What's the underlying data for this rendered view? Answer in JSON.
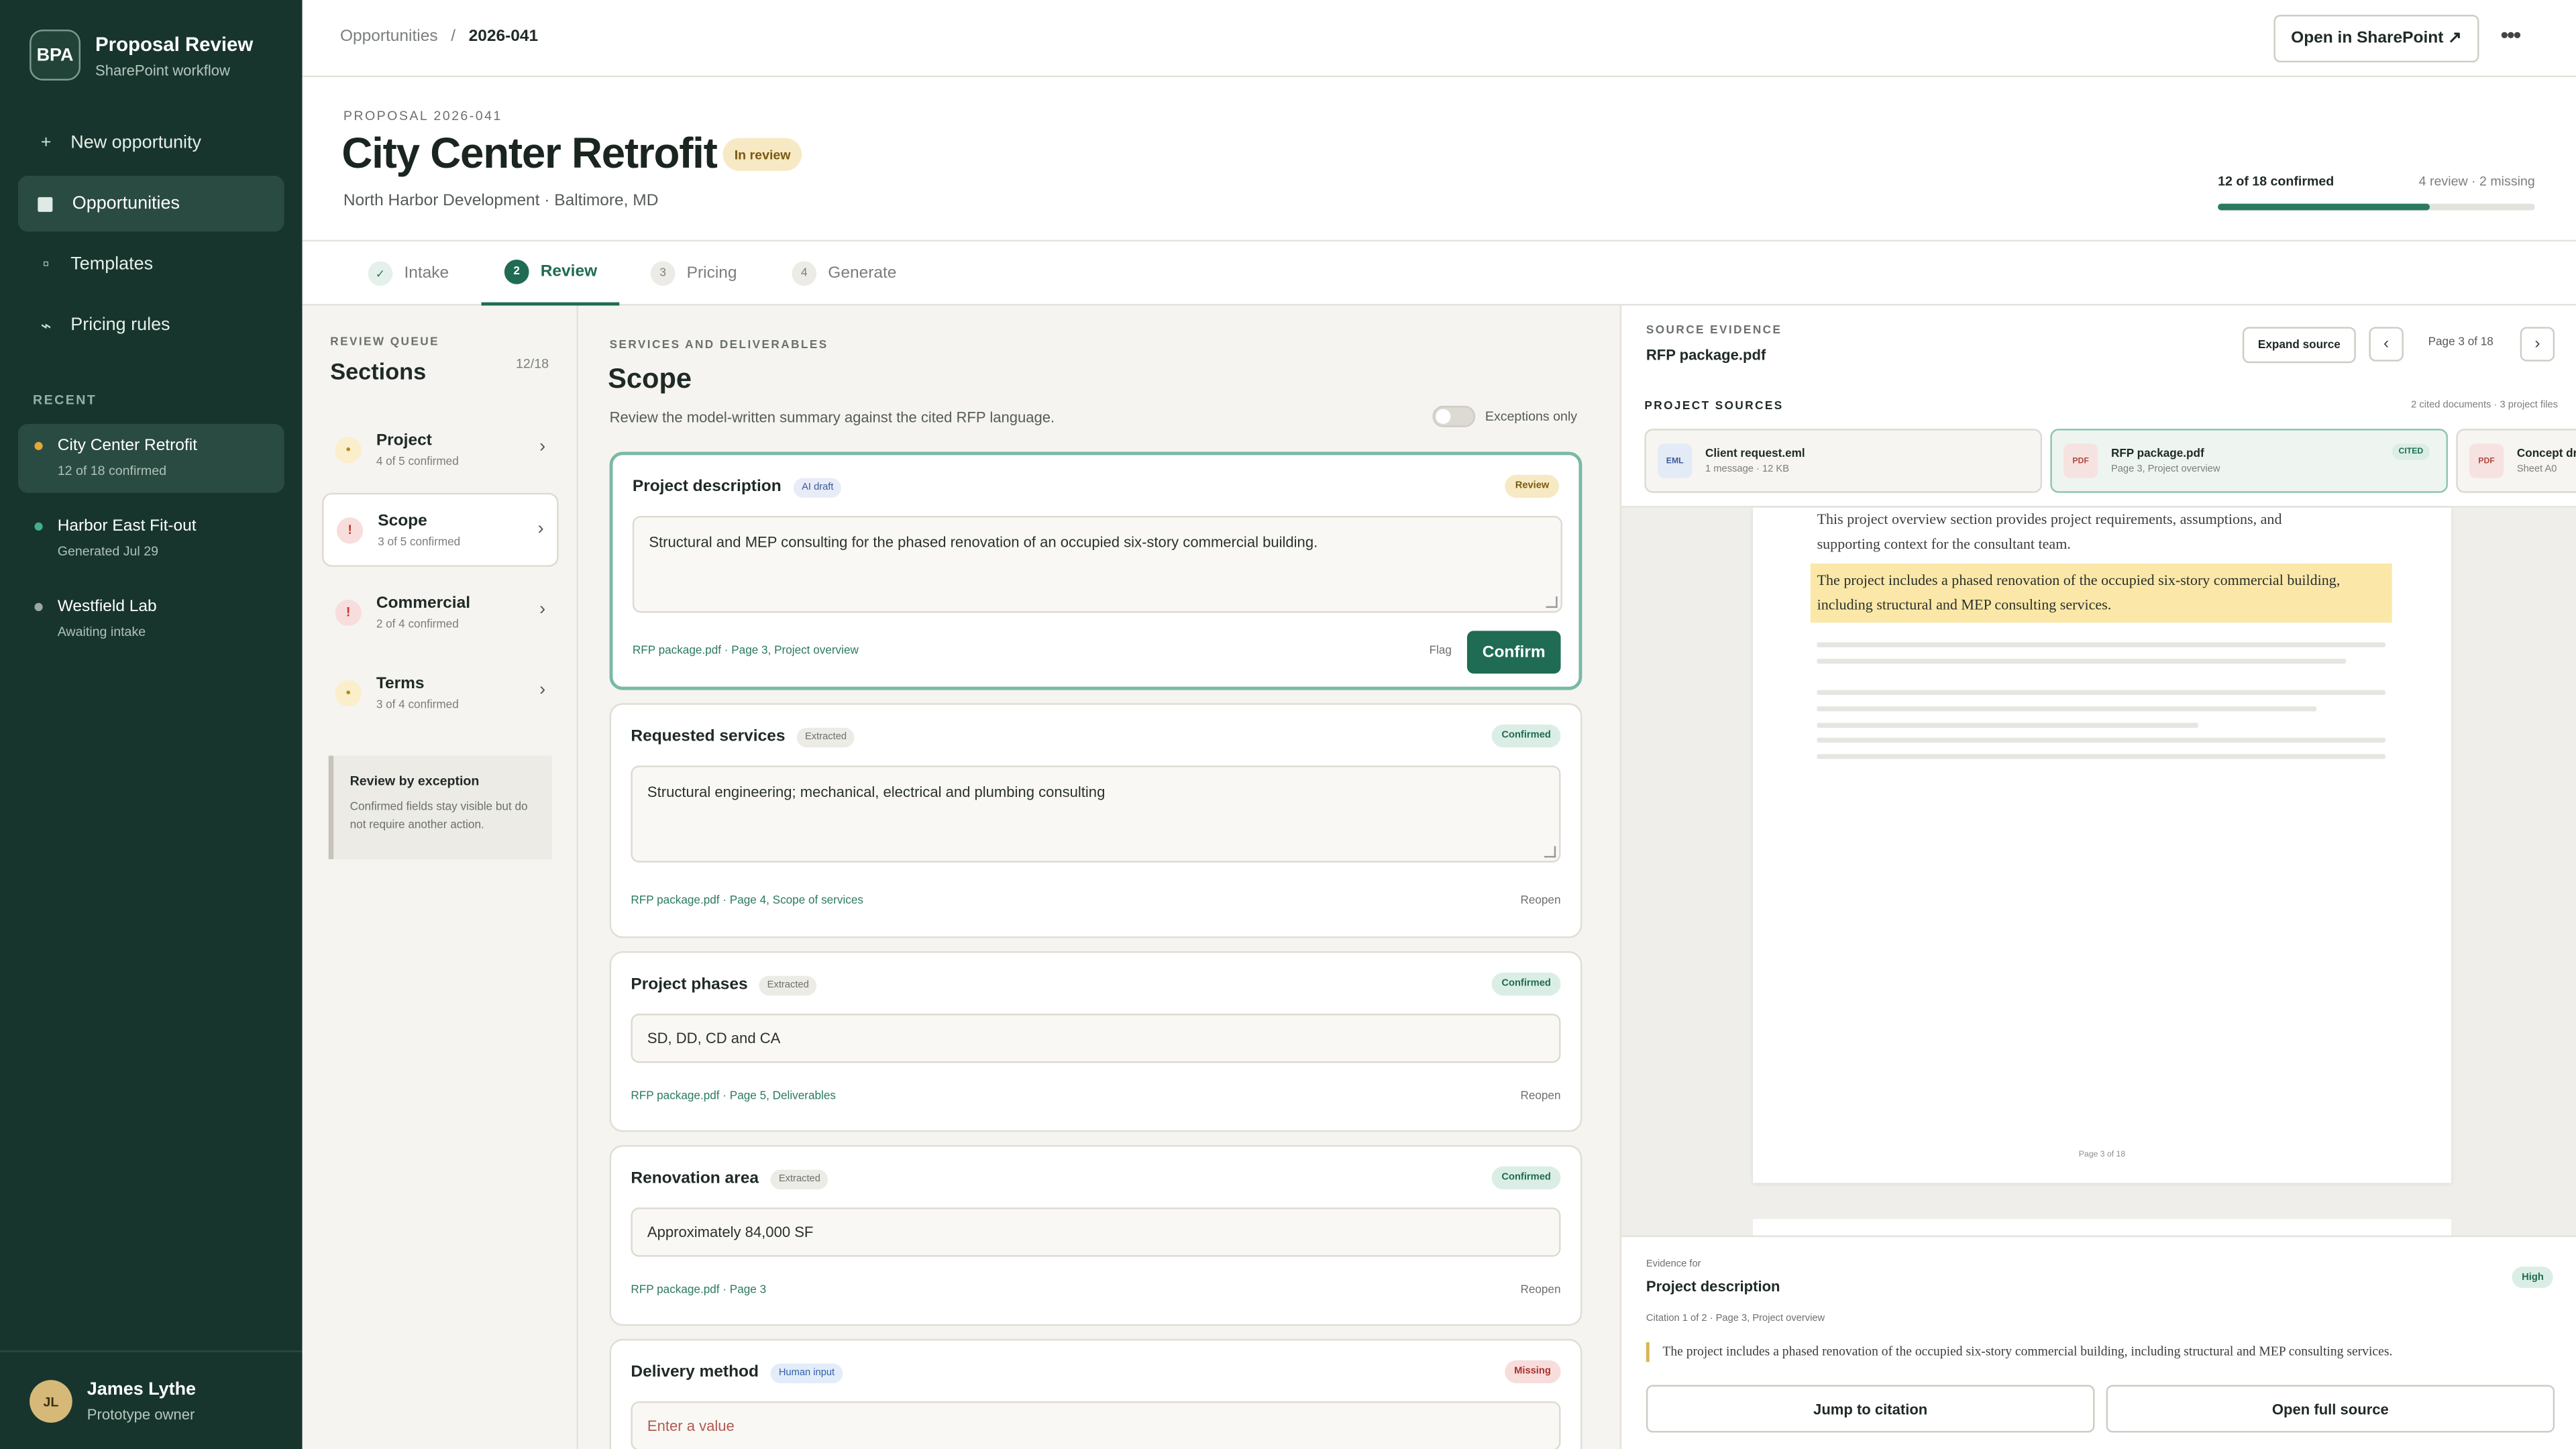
{
  "sidebar": {
    "brand_logo": "BPA",
    "brand_title": "Proposal Review",
    "brand_sub": "SharePoint workflow",
    "nav": [
      {
        "label": "New opportunity",
        "icon": "plus-icon"
      },
      {
        "label": "Opportunities",
        "icon": "square-icon"
      },
      {
        "label": "Templates",
        "icon": "template-icon"
      },
      {
        "label": "Pricing rules",
        "icon": "pricing-icon"
      }
    ],
    "recent_label": "RECENT",
    "recent": [
      {
        "title": "City Center Retrofit",
        "sub": "12 of 18 confirmed",
        "dot": "#e0a93a"
      },
      {
        "title": "Harbor East Fit-out",
        "sub": "Generated Jul 29",
        "dot": "#3fb08a"
      },
      {
        "title": "Westfield Lab",
        "sub": "Awaiting intake",
        "dot": "#9aa8a2"
      }
    ],
    "user": {
      "initials": "JL",
      "name": "James Lythe",
      "role": "Prototype owner"
    }
  },
  "topbar": {
    "crumb_parent": "Opportunities",
    "crumb_sep": "/",
    "crumb_current": "2026-041",
    "open_sharepoint": "Open in SharePoint ↗",
    "more": "•••"
  },
  "header": {
    "eyebrow": "PROPOSAL 2026-041",
    "title": "City Center Retrofit",
    "status": "In review",
    "subtitle": "North Harbor Development · Baltimore, MD",
    "progress_label": "12 of 18 confirmed",
    "progress_right": "4 review · 2 missing",
    "progress_fraction": 0.667
  },
  "tabs": [
    {
      "num": "✓",
      "label": "Intake"
    },
    {
      "num": "2",
      "label": "Review"
    },
    {
      "num": "3",
      "label": "Pricing"
    },
    {
      "num": "4",
      "label": "Generate"
    }
  ],
  "queue": {
    "eyebrow": "REVIEW QUEUE",
    "title": "Sections",
    "count": "12/18",
    "items": [
      {
        "icon": "•",
        "name": "Project",
        "sub": "4 of 5 confirmed"
      },
      {
        "icon": "!",
        "name": "Scope",
        "sub": "3 of 5 confirmed"
      },
      {
        "icon": "!",
        "name": "Commercial",
        "sub": "2 of 4 confirmed"
      },
      {
        "icon": "•",
        "name": "Terms",
        "sub": "3 of 4 confirmed"
      }
    ],
    "note_title": "Review by exception",
    "note_text": "Confirmed fields stay visible but do not require another action."
  },
  "scope": {
    "eyebrow": "SERVICES AND DELIVERABLES",
    "title": "Scope",
    "desc": "Review the model-written summary against the cited RFP language.",
    "toggle_label": "Exceptions only",
    "cards": [
      {
        "title": "Project description",
        "tag": "AI draft",
        "status": "Review",
        "value": "Structural and MEP consulting for the phased renovation of an occupied six-story commercial building.",
        "cite": "RFP package.pdf · Page 3, Project overview",
        "flag": "Flag",
        "confirm": "Confirm"
      },
      {
        "title": "Requested services",
        "tag": "Extracted",
        "status": "Confirmed",
        "value": "Structural engineering; mechanical, electrical and plumbing consulting",
        "cite": "RFP package.pdf · Page 4, Scope of services",
        "reopen": "Reopen"
      },
      {
        "title": "Project phases",
        "tag": "Extracted",
        "status": "Confirmed",
        "value": "SD, DD, CD and CA",
        "cite": "RFP package.pdf · Page 5, Deliverables",
        "reopen": "Reopen"
      },
      {
        "title": "Renovation area",
        "tag": "Extracted",
        "status": "Confirmed",
        "value": "Approximately 84,000 SF",
        "cite": "RFP package.pdf · Page 3",
        "reopen": "Reopen"
      },
      {
        "title": "Delivery method",
        "tag": "Human input",
        "status": "Missing",
        "placeholder": "Enter a value"
      }
    ]
  },
  "evidence": {
    "eyebrow": "SOURCE EVIDENCE",
    "file": "RFP package.pdf",
    "expand": "Expand source",
    "prev": "‹",
    "next": "›",
    "page_label": "Page 3 of 18",
    "sources_label": "PROJECT SOURCES",
    "sources_count": "2 cited documents · 3 project files",
    "sources": [
      {
        "icon": "EML",
        "name": "Client request.eml",
        "sub": "1 message · 12 KB"
      },
      {
        "icon": "PDF",
        "name": "RFP package.pdf",
        "sub": "Page 3, Project overview",
        "badge": "CITED"
      },
      {
        "icon": "PDF",
        "name": "Concept drawings.pdf",
        "sub": "Sheet A0"
      }
    ],
    "doc_intro": "This project overview section provides project requirements, assumptions, and supporting context for the consultant team.",
    "doc_highlight": "The project includes a phased renovation of the occupied six-story commercial building, including structural and MEP consulting services.",
    "doc_page": "Page 3 of 18",
    "ev_label": "Evidence for",
    "ev_title": "Project description",
    "ev_conf": "High",
    "ev_cite": "Citation 1 of 2 · Page 3, Project overview",
    "ev_quote": "The project includes a phased renovation of the occupied six-story commercial building, including structural and MEP consulting services.",
    "jump": "Jump to citation",
    "open_full": "Open full source"
  }
}
